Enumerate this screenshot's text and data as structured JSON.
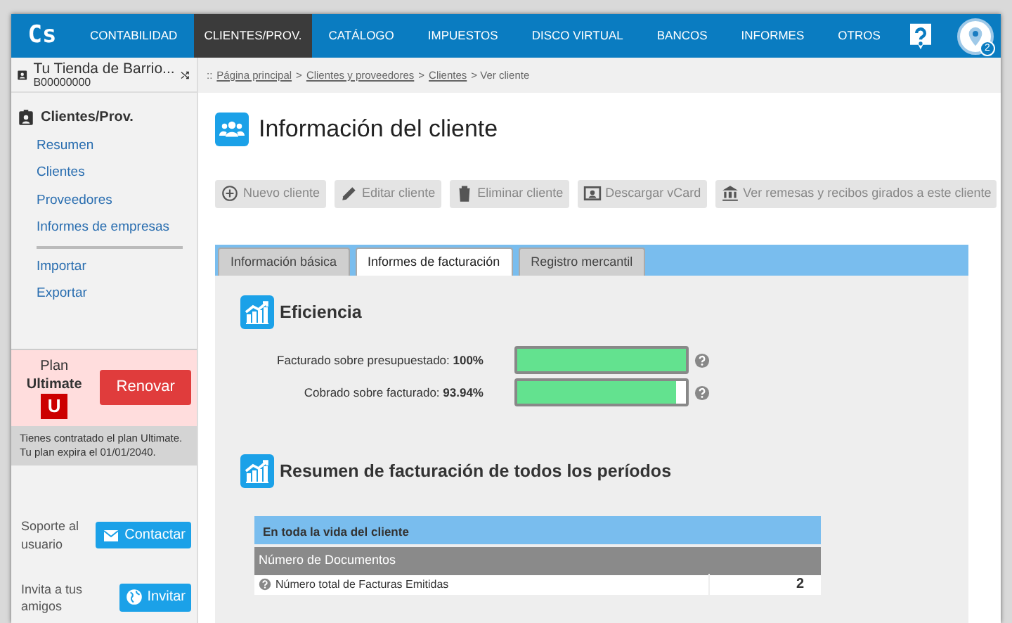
{
  "logo": "Cs",
  "nav": [
    {
      "label": "CONTABILIDAD",
      "selected": false
    },
    {
      "label": "CLIENTES/PROV.",
      "selected": true
    },
    {
      "label": "CATÁLOGO",
      "selected": false
    },
    {
      "label": "IMPUESTOS",
      "selected": false
    },
    {
      "label": "DISCO VIRTUAL",
      "selected": false
    },
    {
      "label": "BANCOS",
      "selected": false
    },
    {
      "label": "INFORMES",
      "selected": false
    },
    {
      "label": "OTROS",
      "selected": false
    }
  ],
  "notification_badge": "2",
  "company": {
    "name": "Tu Tienda de Barrio...",
    "id": "B00000000"
  },
  "sidebar": {
    "section": "Clientes/Prov.",
    "items": [
      "Resumen",
      "Clientes",
      "Proveedores",
      "Informes de empresas"
    ],
    "items_2": [
      "Importar",
      "Exportar"
    ]
  },
  "plan": {
    "label": "Plan",
    "name": "Ultimate",
    "letter": "U",
    "button": "Renovar",
    "note": "Tienes contratado el plan Ultimate. Tu plan expira el 01/01/2040."
  },
  "support": [
    {
      "text": "Soporte al usuario",
      "button": "Contactar"
    },
    {
      "text": "Invita a tus amigos",
      "button": "Invitar"
    }
  ],
  "breadcrumb": [
    {
      "text": "::",
      "kind": "text"
    },
    {
      "text": "Página principal",
      "kind": "link"
    },
    {
      "text": ">",
      "kind": "text"
    },
    {
      "text": "Clientes y proveedores",
      "kind": "link"
    },
    {
      "text": ">",
      "kind": "text"
    },
    {
      "text": "Clientes",
      "kind": "link"
    },
    {
      "text": "> Ver cliente",
      "kind": "text"
    }
  ],
  "title": "Información del cliente",
  "toolbar": [
    {
      "label": "Nuevo cliente",
      "disabled": true
    },
    {
      "label": "Editar cliente",
      "disabled": true
    },
    {
      "label": "Eliminar cliente",
      "disabled": true
    },
    {
      "label": "Descargar vCard",
      "disabled": true
    },
    {
      "label": "Ver remesas y recibos girados a este cliente",
      "disabled": true
    }
  ],
  "tabs": [
    {
      "label": "Información básica",
      "selected": false
    },
    {
      "label": "Informes de facturación",
      "selected": true
    },
    {
      "label": "Registro mercantil",
      "selected": false
    }
  ],
  "efficiency": {
    "heading": "Eficiencia",
    "metrics": [
      {
        "label": "Facturado sobre presupuestado:",
        "value": "100%",
        "level": 1.0
      },
      {
        "label": "Cobrado sobre facturado:",
        "value": "93.94%",
        "level": 0.9394
      }
    ]
  },
  "summary": {
    "heading": "Resumen de facturación de todos los períodos",
    "table_title": "En toda la vida del cliente",
    "group": "Número de Documentos",
    "rows": [
      {
        "label": "Número total de Facturas Emitidas",
        "value": "2"
      }
    ]
  }
}
